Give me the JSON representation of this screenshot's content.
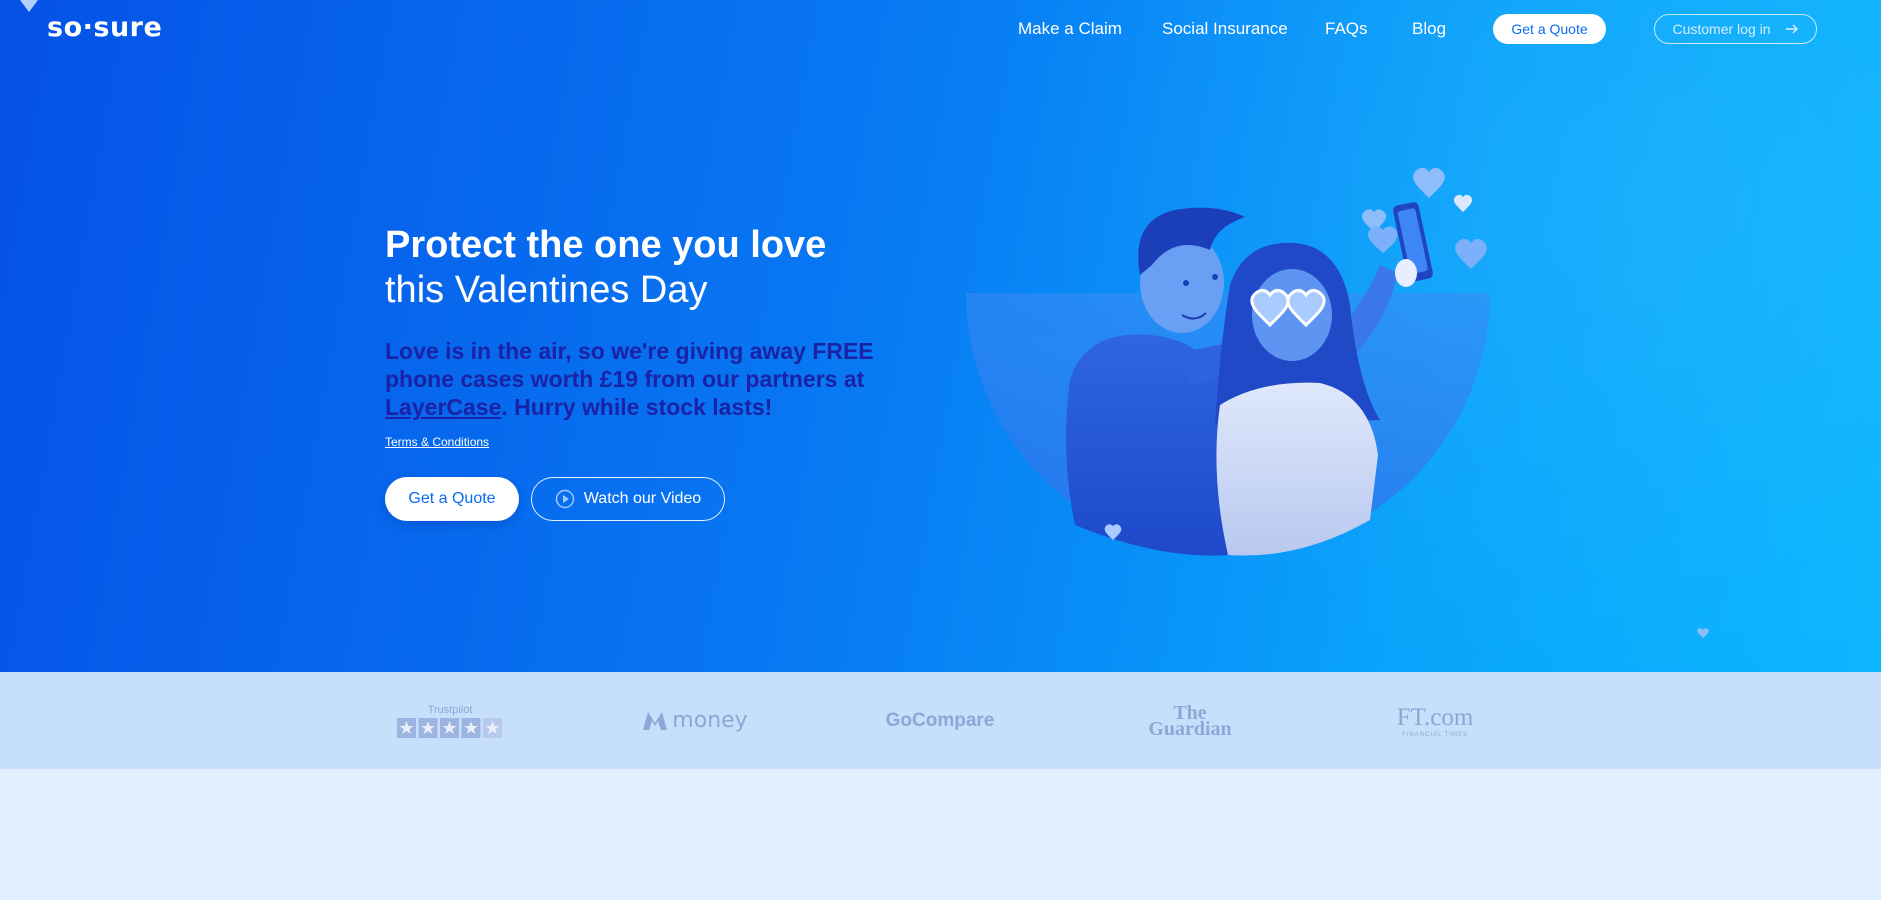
{
  "brand": {
    "logo_text": "so·sure"
  },
  "nav": {
    "links": [
      "Make a Claim",
      "Social Insurance",
      "FAQs",
      "Blog"
    ],
    "quote_label": "Get a Quote",
    "login_label": "Customer log in"
  },
  "hero": {
    "title": "Protect the one you love",
    "subtitle": "this Valentines Day",
    "promo_before": "Love is in the air, so we're giving away FREE phone cases worth £19 from our partners at ",
    "promo_link": "LayerCase",
    "promo_after": ". Hurry while stock lasts!",
    "terms": "Terms & Conditions",
    "cta_quote": "Get a Quote",
    "cta_video": "Watch our Video"
  },
  "press": {
    "trustpilot_label": "Trustpilot",
    "trustpilot_stars": 5,
    "money": "money",
    "gocompare": "GoCompare",
    "guardian_line1": "The",
    "guardian_line2": "Guardian",
    "ft": "FT.com",
    "ft_tagline": "FINANCIAL TIMES"
  },
  "colors": {
    "hero_start": "#0552e6",
    "hero_end": "#0bb6fe",
    "promo_text": "#1a22a6",
    "press_bg": "#c6dffb",
    "page_bg": "#e1eefd"
  },
  "icons": [
    "play-circle-icon",
    "arrow-right-icon",
    "heart-icon",
    "star-icon"
  ]
}
